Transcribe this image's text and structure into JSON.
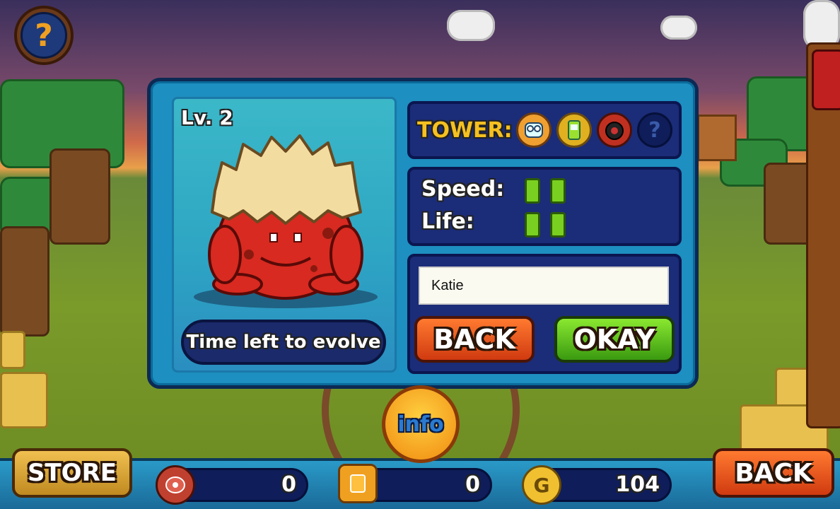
{
  "help_button": {
    "label": "?"
  },
  "dialog": {
    "level": "Lv. 2",
    "evolve_label": "Time left to evolve",
    "tower": {
      "label": "TOWER:",
      "icons": [
        "robot-tower-icon",
        "battery-tower-icon",
        "bomb-tower-icon",
        "locked-tower-icon"
      ],
      "locked_label": "?"
    },
    "stats": {
      "speed_label": "Speed:",
      "speed_value": 2,
      "life_label": "Life:",
      "life_value": 2
    },
    "name_input": {
      "value": "Katie"
    },
    "back_label": "BACK",
    "okay_label": "OKAY"
  },
  "info_button": {
    "label": "info"
  },
  "bottom_bar": {
    "store_label": "STORE",
    "back_label": "BACK",
    "meat_count": "0",
    "juice_count": "0",
    "gold_icon_label": "G",
    "gold_count": "104"
  },
  "colors": {
    "dialog_bg": "#1d8fc0",
    "panel_bg": "#1b2c78",
    "back_button": "#d03a10",
    "okay_button": "#3a9a10",
    "stat_pip": "#7ad020",
    "tower_label": "#f5c020"
  }
}
